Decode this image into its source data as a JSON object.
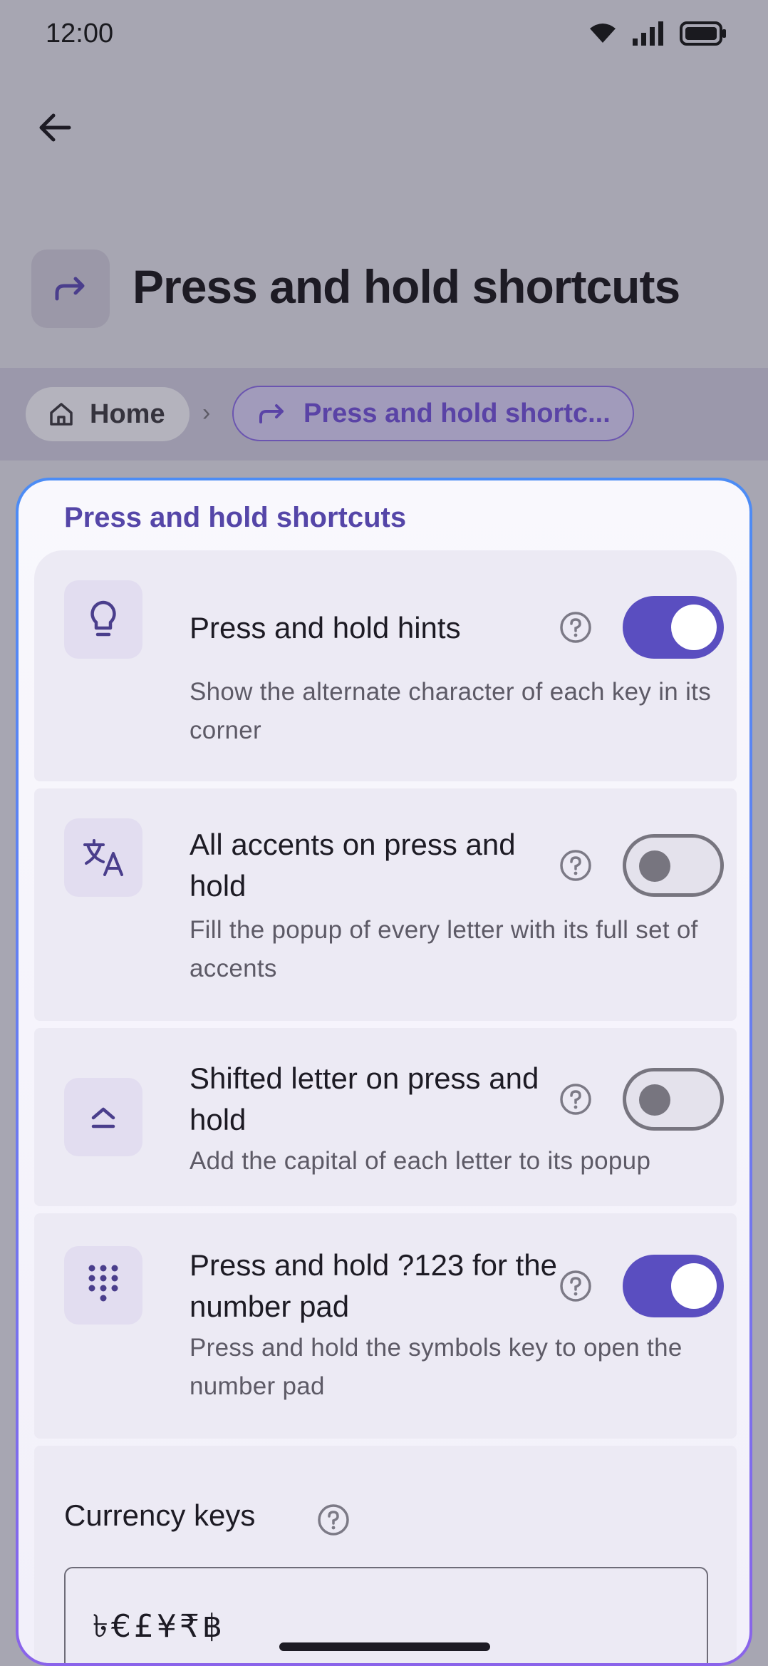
{
  "status_bar": {
    "time": "12:00"
  },
  "header": {
    "title": "Press and hold shortcuts"
  },
  "breadcrumb": {
    "home": "Home",
    "separator": "›",
    "current": "Press and hold shortc..."
  },
  "card": {
    "section_title": "Press and hold shortcuts"
  },
  "settings": [
    {
      "title": "Press and hold hints",
      "description": "Show the alternate character of each key in its corner",
      "icon": "lightbulb-icon",
      "enabled": true
    },
    {
      "title": "All accents on press and hold",
      "description": "Fill the popup of every letter with its full set of accents",
      "icon": "translate-icon",
      "enabled": false
    },
    {
      "title": "Shifted letter on press and hold",
      "description": "Add the capital of each letter to its popup",
      "icon": "shift-icon",
      "enabled": false
    },
    {
      "title": "Press and hold ?123 for the number pad",
      "description": "Press and hold the symbols key to open the number pad",
      "icon": "dialpad-icon",
      "enabled": true
    }
  ],
  "currency": {
    "label": "Currency keys",
    "value": "৳€£¥₹฿"
  },
  "colors": {
    "accent": "#5a4ec0",
    "section_title": "#5546a8",
    "card_border_start": "#4c8cf5",
    "card_border_end": "#8a63ea"
  }
}
